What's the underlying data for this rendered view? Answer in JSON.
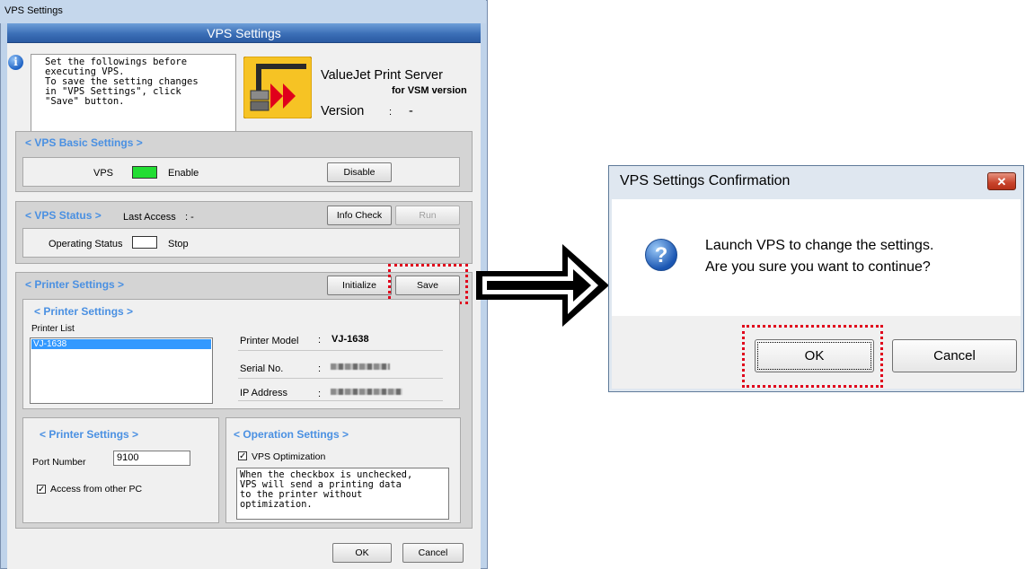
{
  "vps_window": {
    "title": "VPS Settings",
    "header": "VPS Settings",
    "intro_text": "Set the followings before\nexecuting VPS.\nTo save the setting changes\nin \"VPS Settings\", click\n\"Save\" button.",
    "product_name": "ValueJet Print Server",
    "product_edition": "for VSM version",
    "version_label": "Version",
    "version_sep": ":",
    "version_value": "-"
  },
  "basic_settings": {
    "title": "< VPS Basic Settings >",
    "vps_label": "VPS",
    "status_text": "Enable",
    "status_color": "#22dd33",
    "disable_button": "Disable"
  },
  "vps_status": {
    "title": "< VPS Status >",
    "last_access_label": "Last Access",
    "last_access_value": ":  -",
    "info_check_button": "Info Check",
    "run_button": "Run",
    "operating_status_label": "Operating Status",
    "operating_status_value": "Stop"
  },
  "printer_settings": {
    "title": "< Printer Settings >",
    "initialize_button": "Initialize",
    "save_button": "Save",
    "sub_title": "< Printer Settings >",
    "printer_list_label": "Printer List",
    "printer_list": [
      "VJ-1638"
    ],
    "model_label": "Printer Model",
    "model_value": "VJ-1638",
    "serial_label": "Serial No.",
    "ip_label": "IP Address",
    "colon": ":"
  },
  "port_settings": {
    "title": "< Printer Settings >",
    "port_label": "Port Number",
    "port_value": "9100",
    "access_label": "Access from other PC",
    "access_checked": true
  },
  "operation_settings": {
    "title": "< Operation Settings >",
    "optimization_label": "VPS Optimization",
    "optimization_checked": true,
    "note": "When the checkbox is unchecked,\nVPS will send a printing data\nto the printer without\noptimization."
  },
  "footer": {
    "ok": "OK",
    "cancel": "Cancel"
  },
  "dialog": {
    "title": "VPS Settings Confirmation",
    "close_glyph": "✕",
    "message_line1": "Launch VPS to change the settings.",
    "message_line2": "Are you sure you want to continue?",
    "ok": "OK",
    "cancel": "Cancel",
    "question_glyph": "?"
  },
  "highlight_color": "#e0001b"
}
